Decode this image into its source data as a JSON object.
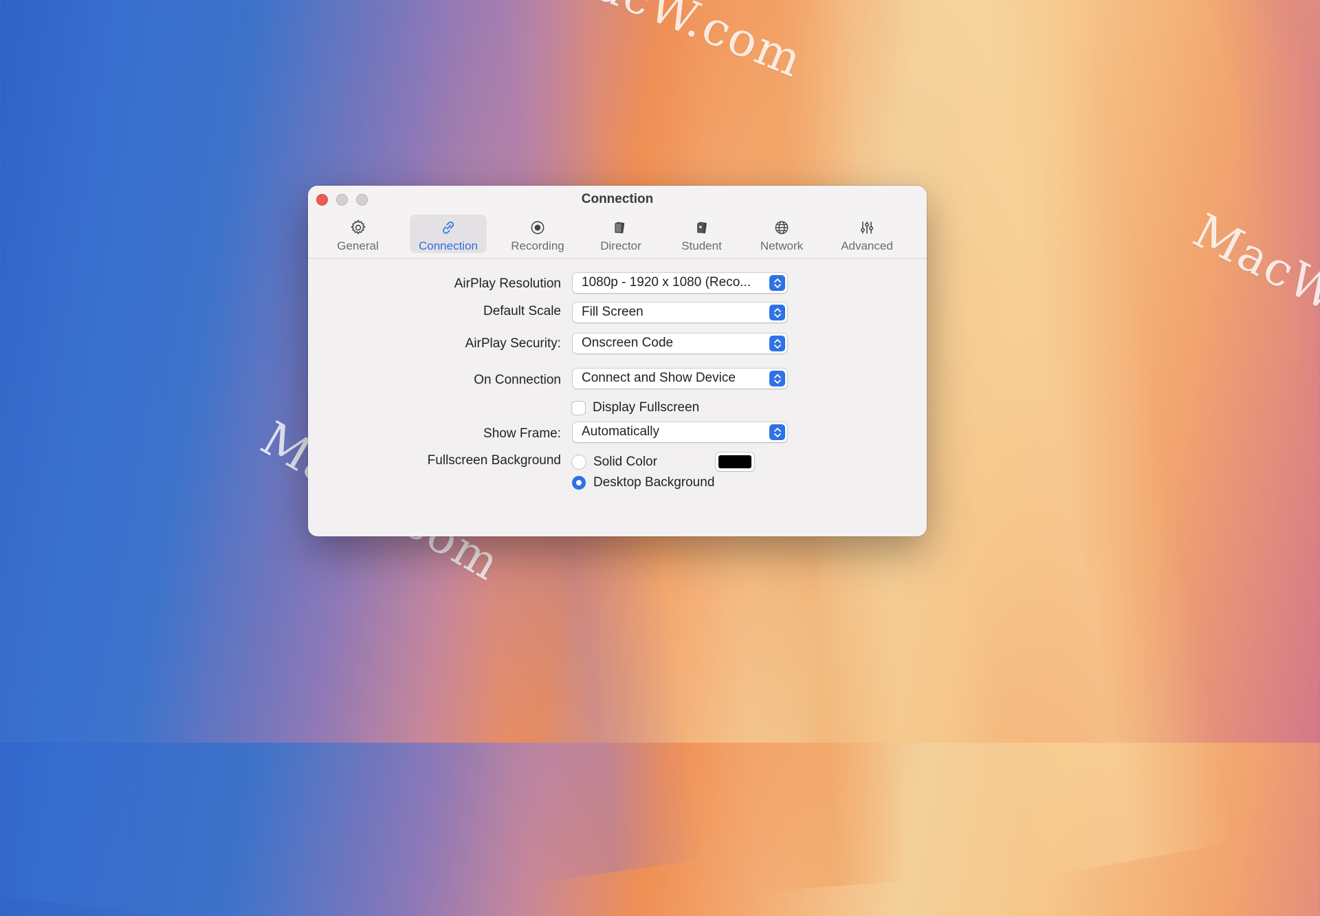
{
  "watermark": {
    "text": "MacW.com"
  },
  "window": {
    "title": "Connection",
    "tabs": [
      {
        "label": "General",
        "icon": "gear-icon"
      },
      {
        "label": "Connection",
        "icon": "link-icon",
        "active": true
      },
      {
        "label": "Recording",
        "icon": "record-icon"
      },
      {
        "label": "Director",
        "icon": "director-icon"
      },
      {
        "label": "Student",
        "icon": "student-icon"
      },
      {
        "label": "Network",
        "icon": "globe-icon"
      },
      {
        "label": "Advanced",
        "icon": "sliders-icon"
      }
    ]
  },
  "settings": {
    "airplay_resolution": {
      "label": "AirPlay Resolution",
      "value": "1080p - 1920 x 1080 (Reco..."
    },
    "default_scale": {
      "label": "Default Scale",
      "value": "Fill Screen"
    },
    "airplay_security": {
      "label": "AirPlay Security:",
      "value": "Onscreen Code"
    },
    "on_connection": {
      "label": "On Connection",
      "value": "Connect and Show Device"
    },
    "display_fullscreen": {
      "label": "Display Fullscreen",
      "checked": false
    },
    "show_frame": {
      "label": "Show Frame:",
      "value": "Automatically"
    },
    "fullscreen_background": {
      "label": "Fullscreen Background",
      "solid_color": {
        "label": "Solid Color",
        "selected": false,
        "color": "#000000"
      },
      "desktop_background": {
        "label": "Desktop Background",
        "selected": true
      }
    }
  },
  "colors": {
    "accent": "#2f72e6",
    "close_button": "#ee5b56"
  }
}
